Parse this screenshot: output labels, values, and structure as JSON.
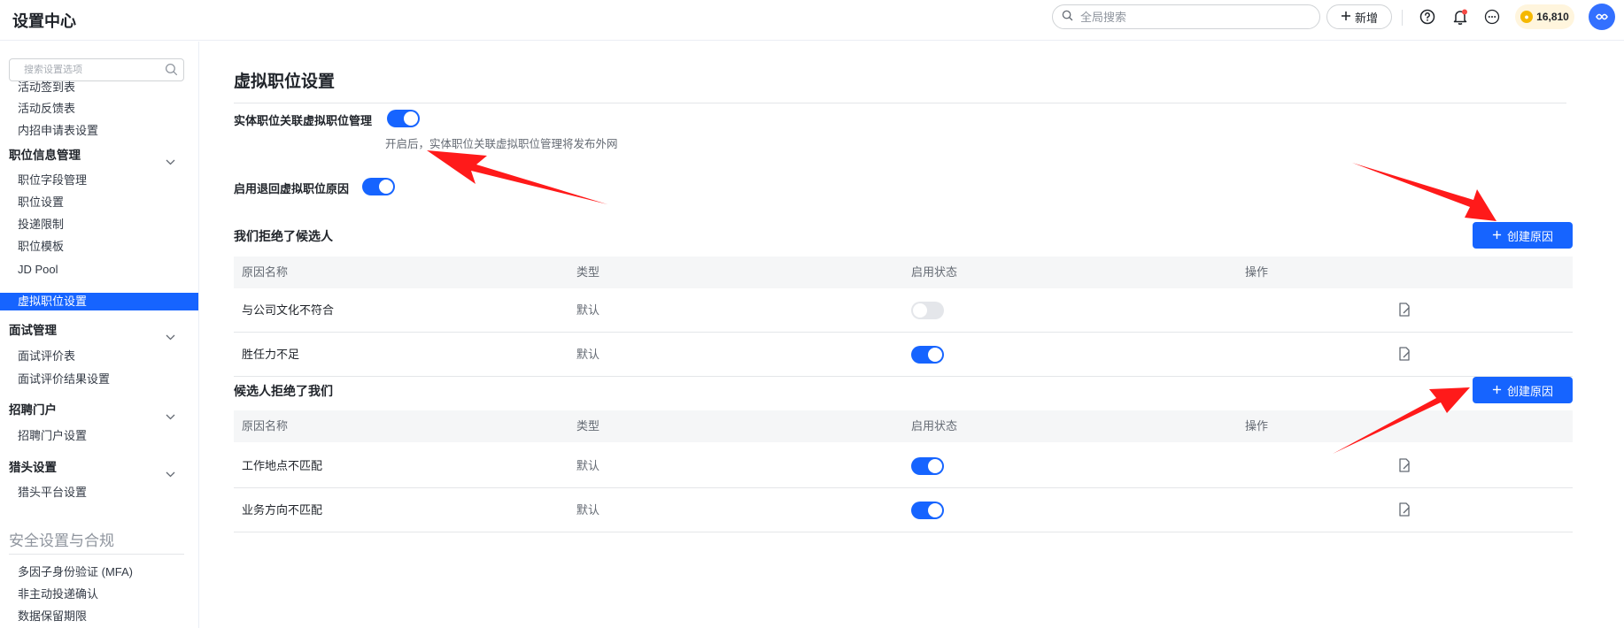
{
  "header": {
    "title": "设置中心",
    "search_placeholder": "全局搜索",
    "new_label": "新增",
    "coins": "16,810"
  },
  "sidebar": {
    "search_placeholder": "搜索设置选项",
    "items_top": [
      "活动签到表",
      "活动反馈表",
      "内招申请表设置"
    ],
    "groups": [
      {
        "label": "职位信息管理",
        "items": [
          "职位字段管理",
          "职位设置",
          "投递限制",
          "职位模板",
          "JD Pool",
          "虚拟职位设置"
        ]
      },
      {
        "label": "面试管理",
        "items": [
          "面试评价表",
          "面试评价结果设置"
        ]
      },
      {
        "label": "招聘门户",
        "items": [
          "招聘门户设置"
        ]
      },
      {
        "label": "猎头设置",
        "items": [
          "猎头平台设置"
        ]
      }
    ],
    "active_item": "虚拟职位设置",
    "section": "安全设置与合规",
    "section_items": [
      "多因子身份验证 (MFA)",
      "非主动投递确认",
      "数据保留期限"
    ]
  },
  "main": {
    "title": "虚拟职位设置",
    "setting1": {
      "label": "实体职位关联虚拟职位管理",
      "enabled": true,
      "hint": "开启后，实体职位关联虚拟职位管理将发布外网"
    },
    "setting2": {
      "label": "启用退回虚拟职位原因",
      "enabled": true
    },
    "columns": [
      "原因名称",
      "类型",
      "启用状态",
      "操作"
    ],
    "create_label": "创建原因",
    "sections": [
      {
        "title": "我们拒绝了候选人",
        "rows": [
          {
            "name": "与公司文化不符合",
            "type": "默认",
            "enabled": false
          },
          {
            "name": "胜任力不足",
            "type": "默认",
            "enabled": true
          }
        ]
      },
      {
        "title": "候选人拒绝了我们",
        "rows": [
          {
            "name": "工作地点不匹配",
            "type": "默认",
            "enabled": true
          },
          {
            "name": "业务方向不匹配",
            "type": "默认",
            "enabled": true
          }
        ]
      }
    ]
  },
  "colors": {
    "accent": "#1664ff",
    "annotation_arrow": "#ff1a1a",
    "coin": "#f5b800"
  }
}
